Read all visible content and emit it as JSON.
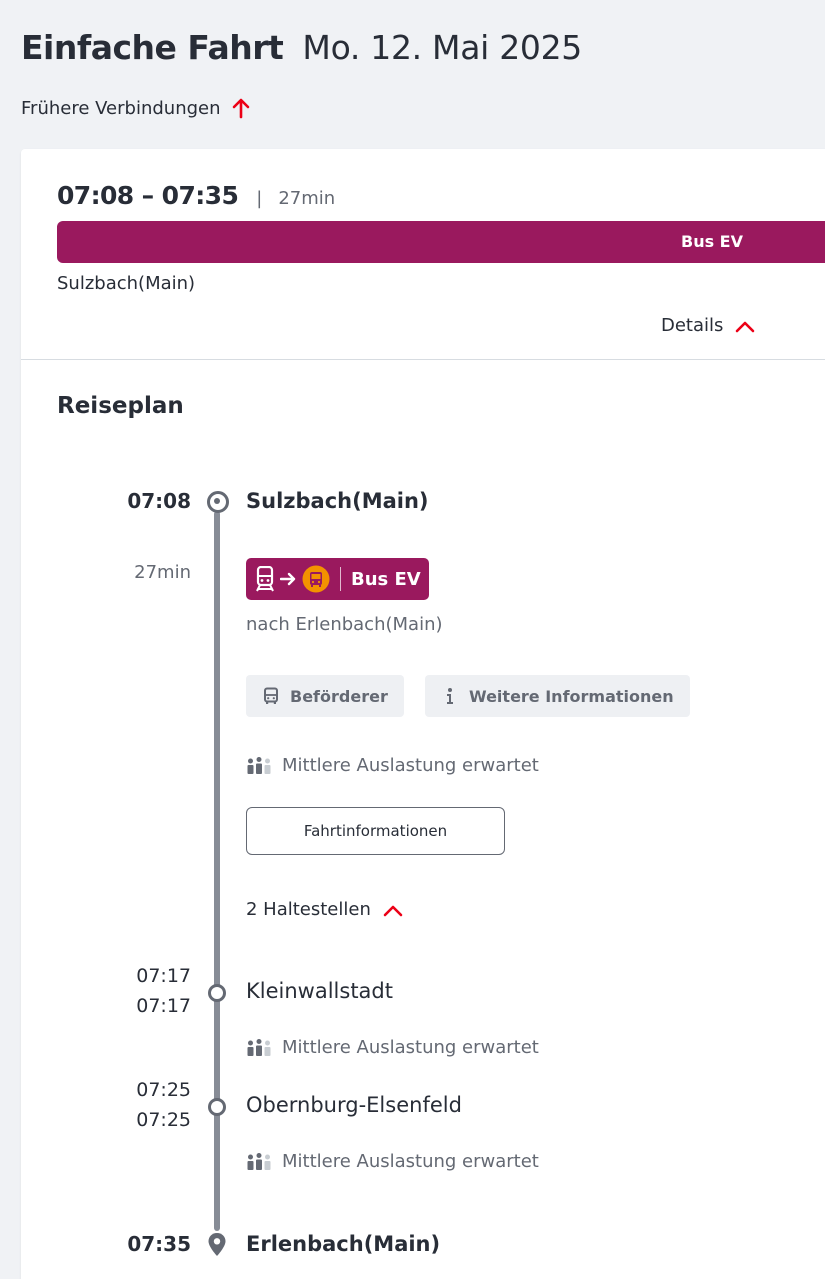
{
  "header": {
    "trip_type": "Einfache Fahrt",
    "date": "Mo. 12. Mai 2025",
    "earlier_connections": "Frühere Verbindungen"
  },
  "connection": {
    "time_range": "07:08 – 07:35",
    "separator": "|",
    "duration": "27min",
    "product": "Bus EV",
    "from": "Sulzbach(Main)",
    "details_label": "Details"
  },
  "plan": {
    "title": "Reiseplan",
    "start": {
      "time": "07:08",
      "station": "Sulzbach(Main)"
    },
    "leg": {
      "duration": "27min",
      "product": "Bus EV",
      "direction": "nach Erlenbach(Main)",
      "operator_label": "Beförderer",
      "more_info_label": "Weitere Informationen",
      "load": "Mittlere Auslastung erwartet",
      "trip_info_button": "Fahrtinformationen",
      "stops_toggle": "2 Haltestellen"
    },
    "stops": [
      {
        "arr": "07:17",
        "dep": "07:17",
        "station": "Kleinwallstadt",
        "load": "Mittlere Auslastung erwartet"
      },
      {
        "arr": "07:25",
        "dep": "07:25",
        "station": "Obernburg-Elsenfeld",
        "load": "Mittlere Auslastung erwartet"
      }
    ],
    "end": {
      "time": "07:35",
      "station": "Erlenbach(Main)"
    }
  },
  "colors": {
    "accent_red": "#ec0016",
    "bus_ev": "#9a195e",
    "timeline": "#878c96",
    "bus_orange": "#f39200"
  },
  "icons": [
    "arrow-up-icon",
    "chevron-up-icon",
    "train-icon",
    "arrow-right-icon",
    "bus-icon",
    "info-icon",
    "occupancy-icon",
    "destination-pin-icon"
  ]
}
